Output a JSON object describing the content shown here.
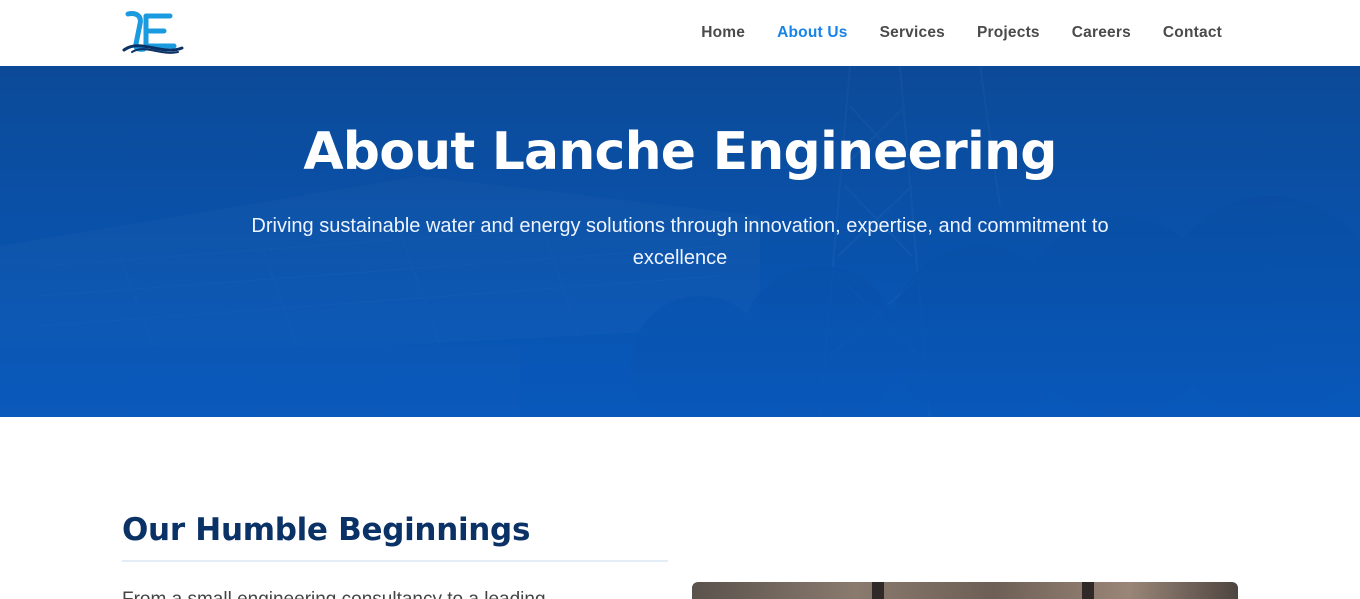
{
  "header": {
    "logo_alt": "Lanche Engineering logo",
    "nav": [
      {
        "label": "Home",
        "active": false
      },
      {
        "label": "About Us",
        "active": true
      },
      {
        "label": "Services",
        "active": false
      },
      {
        "label": "Projects",
        "active": false
      },
      {
        "label": "Careers",
        "active": false
      },
      {
        "label": "Contact",
        "active": false
      }
    ]
  },
  "hero": {
    "title": "About Lanche Engineering",
    "subtitle": "Driving sustainable water and energy solutions through innovation, expertise, and commitment to excellence"
  },
  "section": {
    "title": "Our Humble Beginnings",
    "text": "From a small engineering consultancy to a leading"
  },
  "colors": {
    "brand_blue": "#0a4fa0",
    "nav_active": "#1683e8",
    "heading_navy": "#0b3266"
  }
}
